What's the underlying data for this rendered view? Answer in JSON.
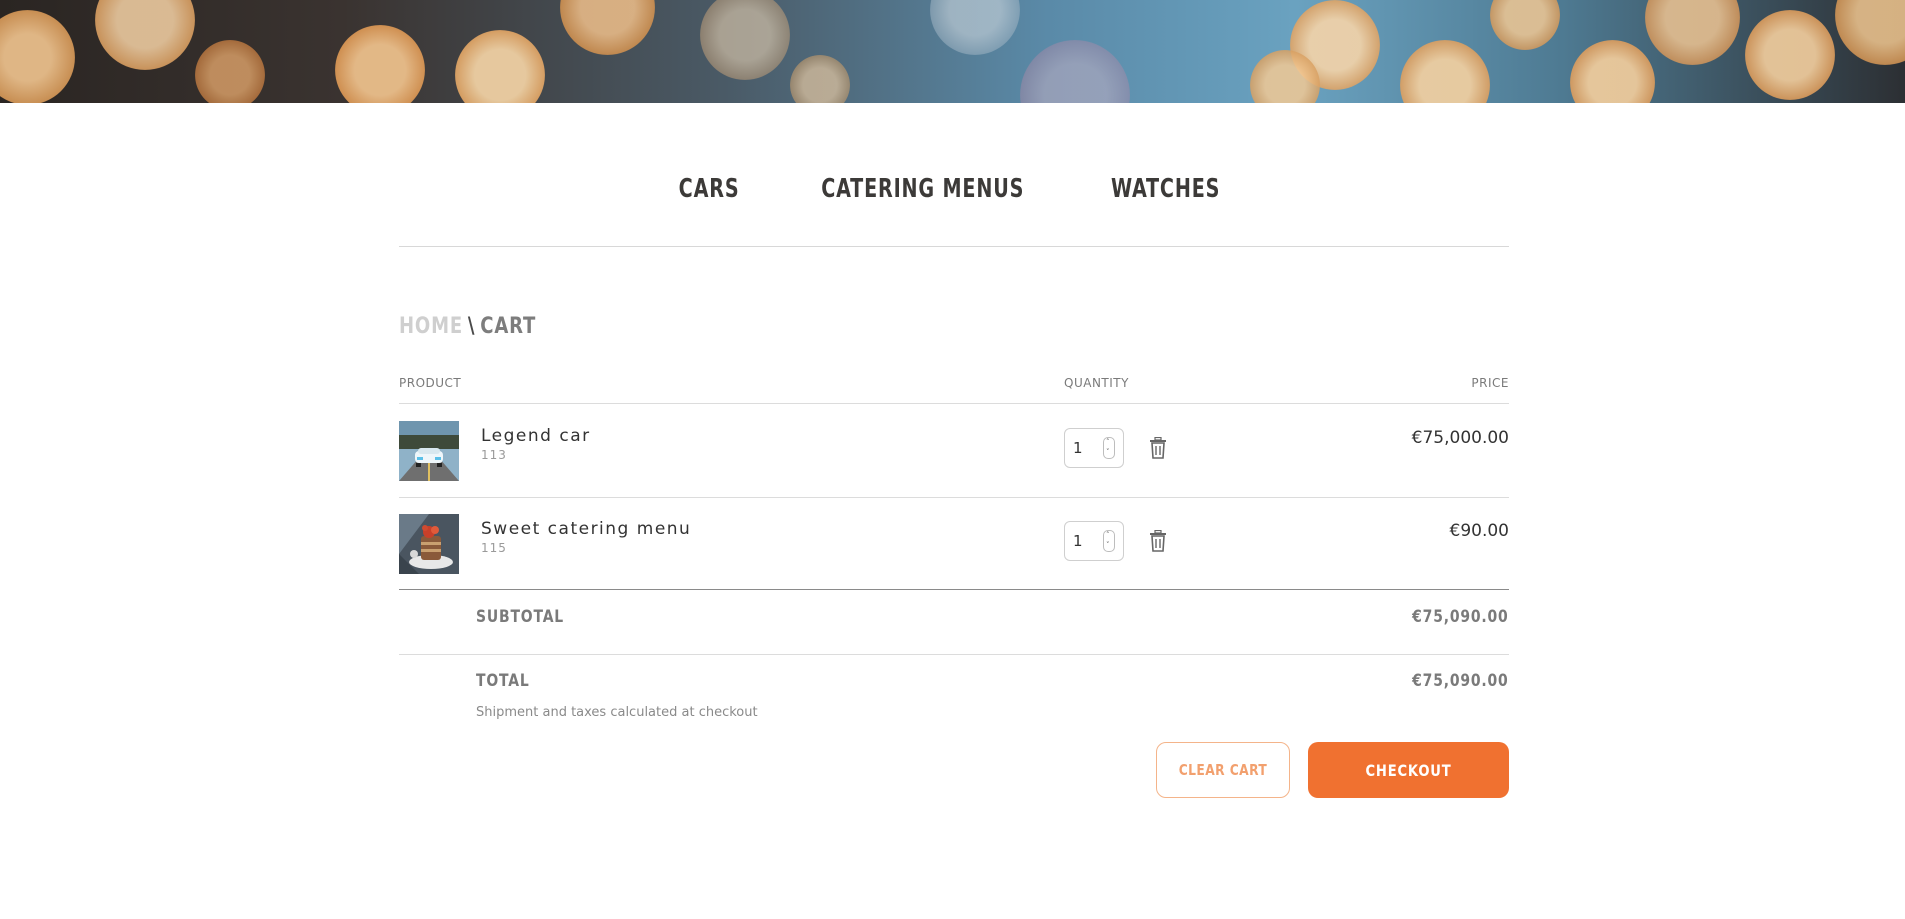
{
  "nav": {
    "items": [
      "CARS",
      "CATERING MENUS",
      "WATCHES"
    ]
  },
  "breadcrumb": {
    "home": "HOME",
    "separator": "\\",
    "current": "CART"
  },
  "cart": {
    "headers": {
      "product": "PRODUCT",
      "quantity": "QUANTITY",
      "price": "PRICE"
    },
    "items": [
      {
        "name": "Legend car",
        "sku": "113",
        "quantity": "1",
        "price": "€75,000.00"
      },
      {
        "name": "Sweet catering menu",
        "sku": "115",
        "quantity": "1",
        "price": "€90.00"
      }
    ],
    "subtotal_label": "SUBTOTAL",
    "subtotal_value": "€75,090.00",
    "total_label": "TOTAL",
    "total_value": "€75,090.00",
    "note": "Shipment and taxes calculated at checkout",
    "clear_label": "CLEAR CART",
    "checkout_label": "CHECKOUT"
  },
  "colors": {
    "accent": "#f07130",
    "accent_light": "#f2a06e"
  },
  "icons": {
    "trash": "trash-icon",
    "spinner_up": "chevron-up-icon",
    "spinner_down": "chevron-down-icon"
  }
}
